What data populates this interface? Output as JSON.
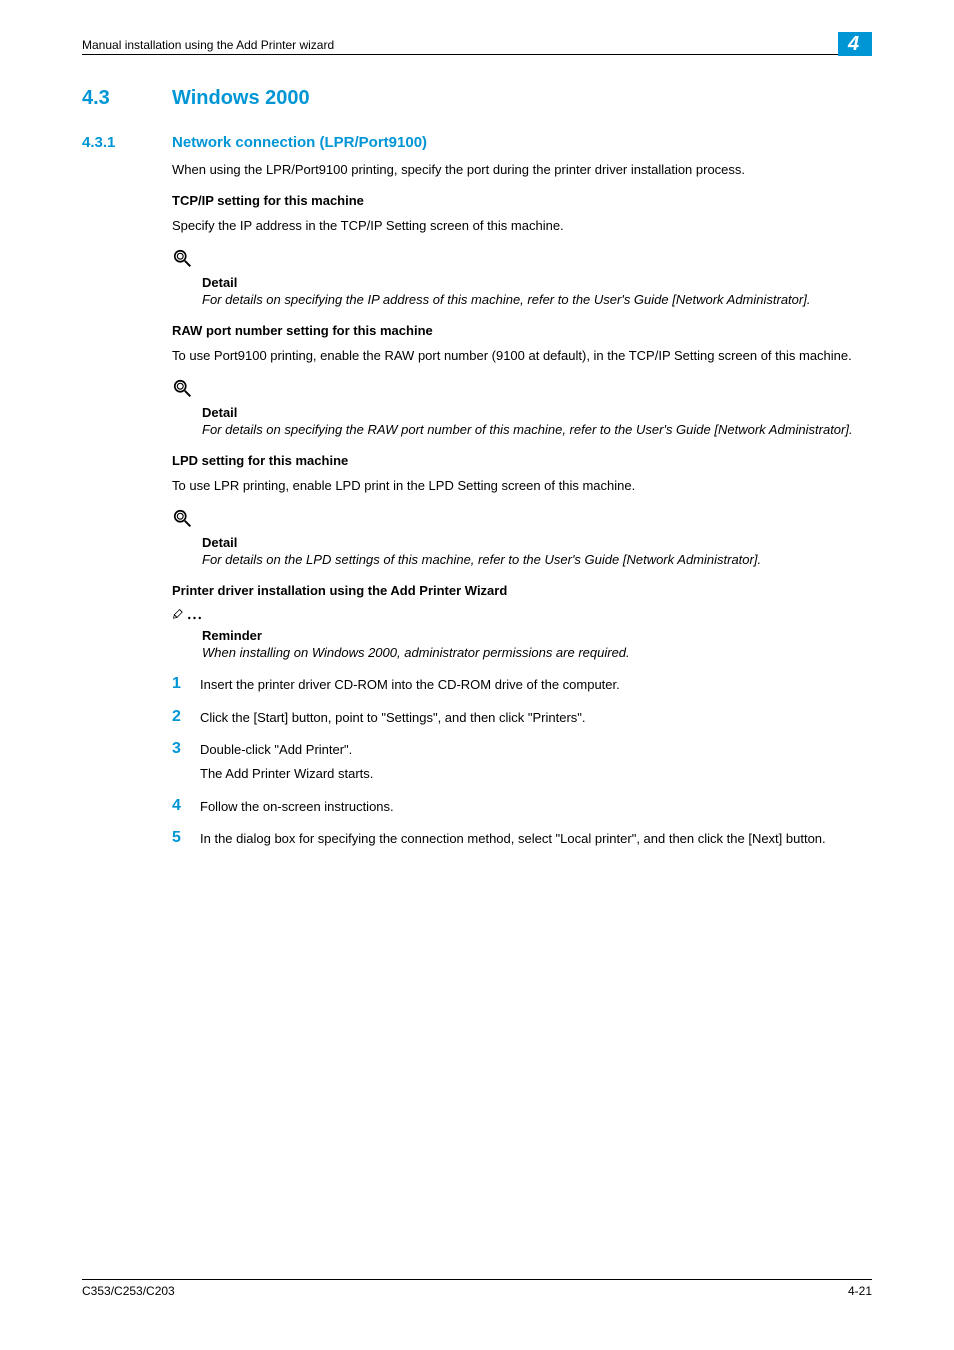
{
  "header": {
    "text": "Manual installation using the Add Printer wizard",
    "chapter": "4"
  },
  "section": {
    "number": "4.3",
    "title": "Windows 2000"
  },
  "subsection": {
    "number": "4.3.1",
    "title": "Network connection (LPR/Port9100)"
  },
  "p1": "When using the LPR/Port9100 printing, specify the port during the printer driver installation process.",
  "h1": "TCP/IP setting for this machine",
  "p2": "Specify the IP address in the TCP/IP Setting screen of this machine.",
  "detail1": {
    "label": "Detail",
    "text": "For details on specifying the IP address of this machine, refer to the User's Guide [Network Administrator]."
  },
  "h2": "RAW port number setting for this machine",
  "p3": "To use Port9100 printing, enable the RAW port number (9100 at default), in the TCP/IP Setting screen of this machine.",
  "detail2": {
    "label": "Detail",
    "text": "For details on specifying the RAW port number of this machine, refer to the User's Guide [Network Administrator]."
  },
  "h3": "LPD setting for this machine",
  "p4": "To use LPR printing, enable LPD print in the LPD Setting screen of this machine.",
  "detail3": {
    "label": "Detail",
    "text": "For details on the LPD settings of this machine, refer to the User's Guide [Network Administrator]."
  },
  "h4": "Printer driver installation using the Add Printer Wizard",
  "reminder": {
    "label": "Reminder",
    "text": "When installing on Windows 2000, administrator permissions are required."
  },
  "steps": {
    "s1": {
      "num": "1",
      "text": "Insert the printer driver CD-ROM into the CD-ROM drive of the computer."
    },
    "s2": {
      "num": "2",
      "text": "Click the [Start] button, point to \"Settings\", and then click \"Printers\"."
    },
    "s3": {
      "num": "3",
      "text": "Double-click \"Add Printer\".",
      "sub": "The Add Printer Wizard starts."
    },
    "s4": {
      "num": "4",
      "text": "Follow the on-screen instructions."
    },
    "s5": {
      "num": "5",
      "text": "In the dialog box for specifying the connection method, select \"Local printer\", and then click the [Next] button."
    }
  },
  "footer": {
    "left": "C353/C253/C203",
    "right": "4-21"
  }
}
